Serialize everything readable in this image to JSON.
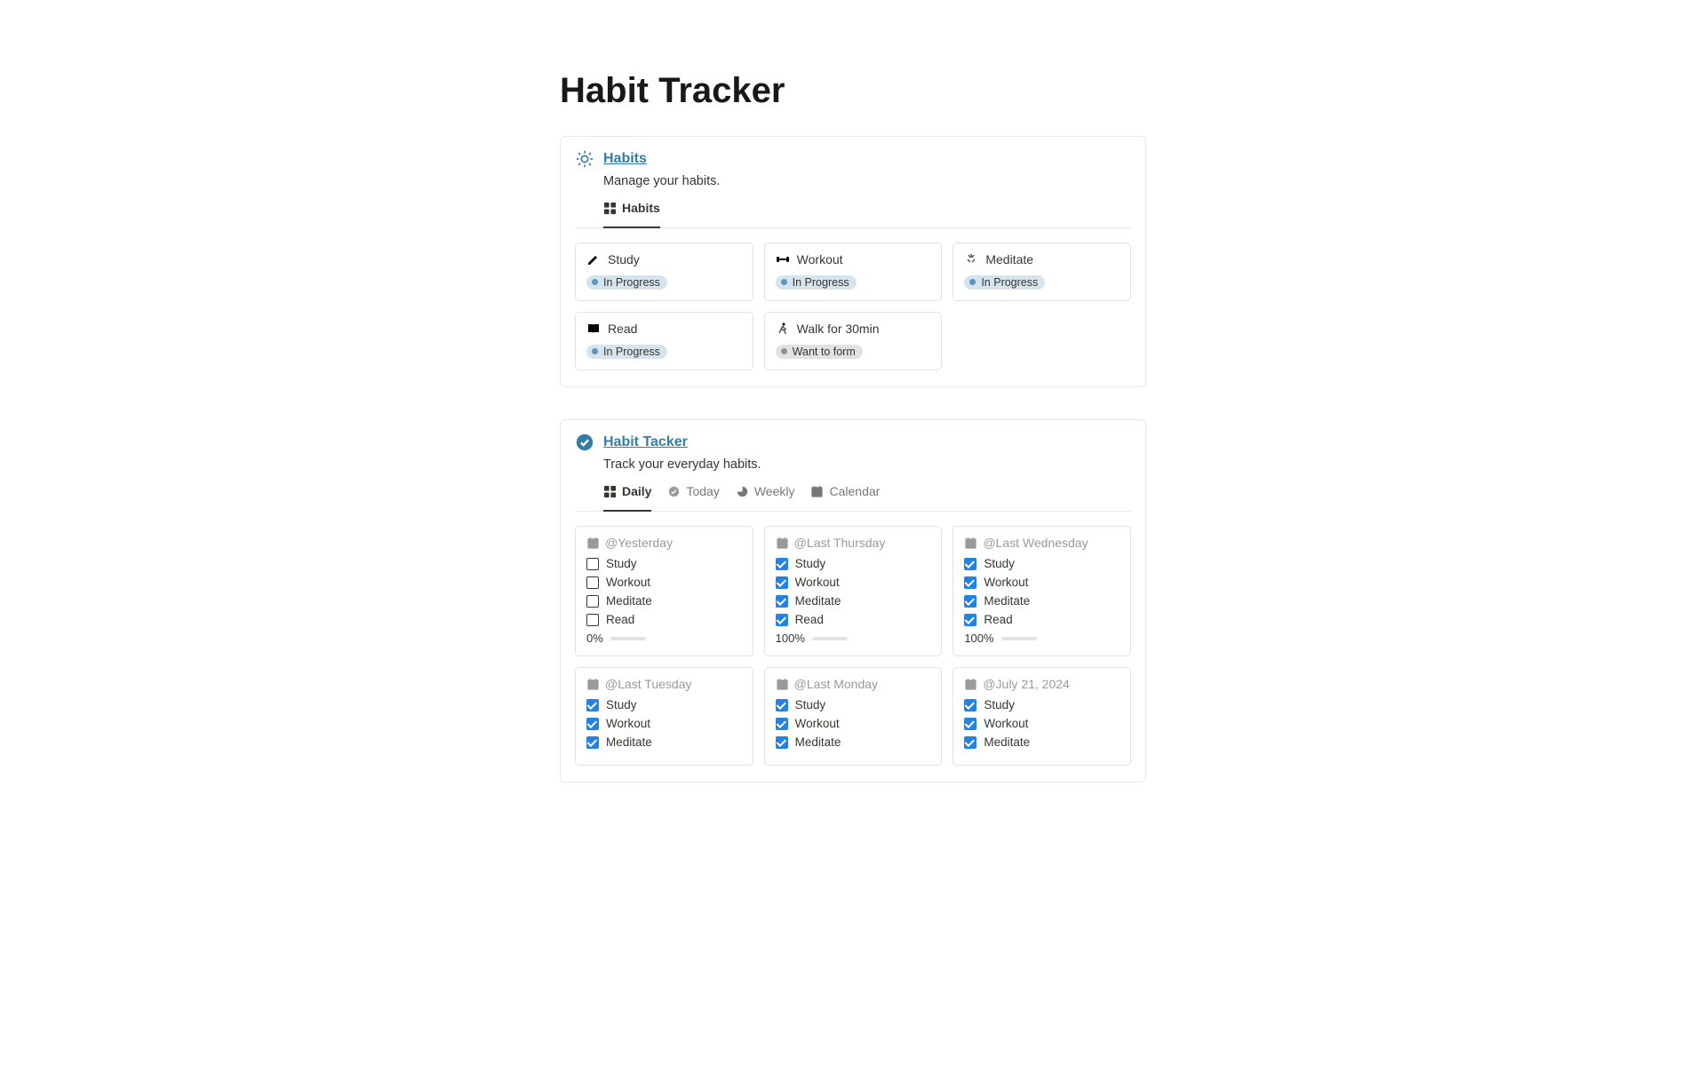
{
  "page_title": "Habit Tracker",
  "habits_panel": {
    "title": "Habits",
    "desc": "Manage your habits.",
    "view_label": "Habits",
    "items": [
      {
        "name": "Study",
        "icon": "study",
        "status": "In Progress",
        "status_kind": "blue"
      },
      {
        "name": "Workout",
        "icon": "workout",
        "status": "In Progress",
        "status_kind": "blue"
      },
      {
        "name": "Meditate",
        "icon": "meditate",
        "status": "In Progress",
        "status_kind": "blue"
      },
      {
        "name": "Read",
        "icon": "read",
        "status": "In Progress",
        "status_kind": "blue"
      },
      {
        "name": "Walk for 30min",
        "icon": "walk",
        "status": "Want to form",
        "status_kind": "gray"
      }
    ]
  },
  "tracker_panel": {
    "title": "Habit Tacker",
    "desc": "Track your everyday habits.",
    "views": [
      {
        "id": "daily",
        "label": "Daily",
        "icon": "grid",
        "active": true
      },
      {
        "id": "today",
        "label": "Today",
        "icon": "checkcircle",
        "active": false
      },
      {
        "id": "weekly",
        "label": "Weekly",
        "icon": "chart",
        "active": false
      },
      {
        "id": "calendar",
        "label": "Calendar",
        "icon": "cal",
        "active": false
      }
    ],
    "days": [
      {
        "title": "@Yesterday",
        "items": [
          {
            "label": "Study",
            "checked": false
          },
          {
            "label": "Workout",
            "checked": false
          },
          {
            "label": "Meditate",
            "checked": false
          },
          {
            "label": "Read",
            "checked": false
          }
        ],
        "progress_text": "0%",
        "progress_pct": 0
      },
      {
        "title": "@Last Thursday",
        "items": [
          {
            "label": "Study",
            "checked": true
          },
          {
            "label": "Workout",
            "checked": true
          },
          {
            "label": "Meditate",
            "checked": true
          },
          {
            "label": "Read",
            "checked": true
          }
        ],
        "progress_text": "100%",
        "progress_pct": 100
      },
      {
        "title": "@Last Wednesday",
        "items": [
          {
            "label": "Study",
            "checked": true
          },
          {
            "label": "Workout",
            "checked": true
          },
          {
            "label": "Meditate",
            "checked": true
          },
          {
            "label": "Read",
            "checked": true
          }
        ],
        "progress_text": "100%",
        "progress_pct": 100
      },
      {
        "title": "@Last Tuesday",
        "items": [
          {
            "label": "Study",
            "checked": true
          },
          {
            "label": "Workout",
            "checked": true
          },
          {
            "label": "Meditate",
            "checked": true
          }
        ],
        "progress_text": "",
        "progress_pct": null
      },
      {
        "title": "@Last Monday",
        "items": [
          {
            "label": "Study",
            "checked": true
          },
          {
            "label": "Workout",
            "checked": true
          },
          {
            "label": "Meditate",
            "checked": true
          }
        ],
        "progress_text": "",
        "progress_pct": null
      },
      {
        "title": "@July 21, 2024",
        "items": [
          {
            "label": "Study",
            "checked": true
          },
          {
            "label": "Workout",
            "checked": true
          },
          {
            "label": "Meditate",
            "checked": true
          }
        ],
        "progress_text": "",
        "progress_pct": null
      }
    ]
  }
}
